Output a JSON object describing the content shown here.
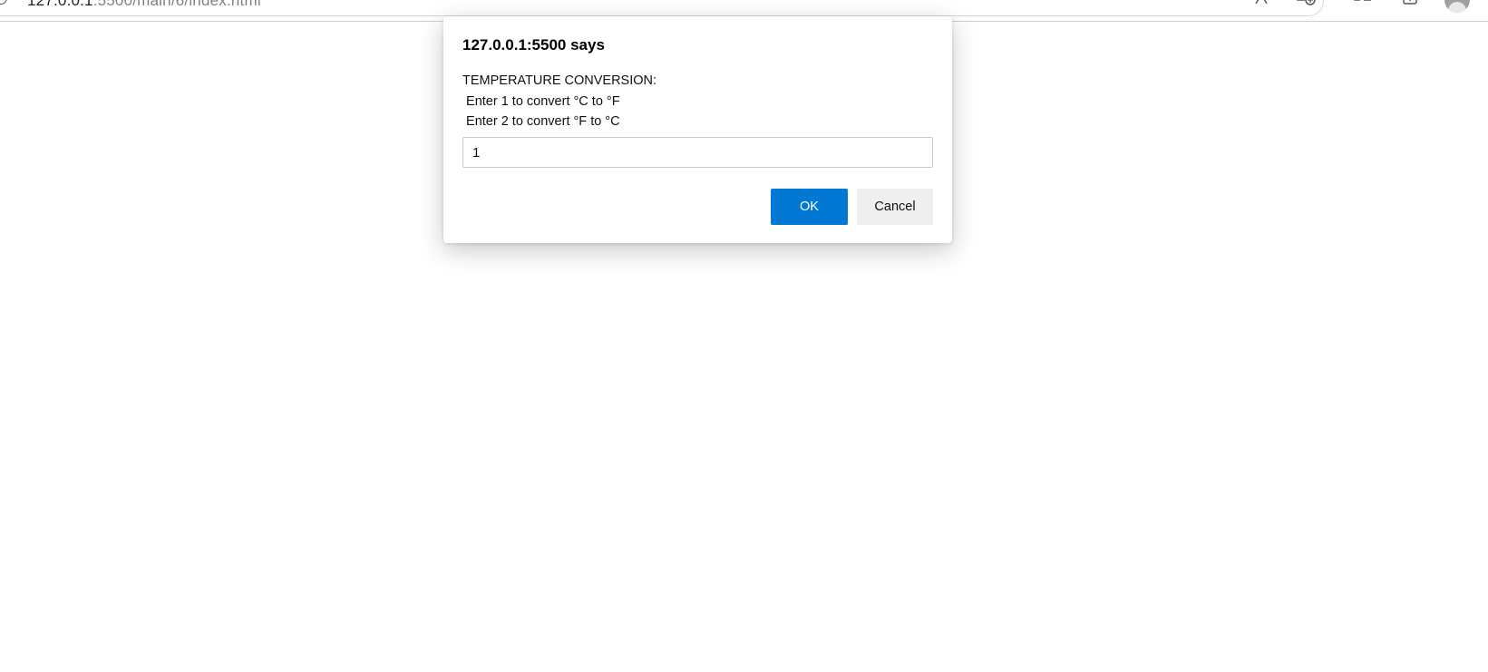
{
  "browser": {
    "url_host": "127.0.0.1",
    "url_path": ":5500/main/6/index.html"
  },
  "dialog": {
    "title": "127.0.0.1:5500 says",
    "message": "TEMPERATURE CONVERSION:\n Enter 1 to convert °C to °F\n Enter 2 to convert °F to °C",
    "input_value": "1",
    "ok_label": "OK",
    "cancel_label": "Cancel"
  },
  "colors": {
    "ok_button_bg": "#0078d4",
    "cancel_button_bg": "#efefef"
  }
}
